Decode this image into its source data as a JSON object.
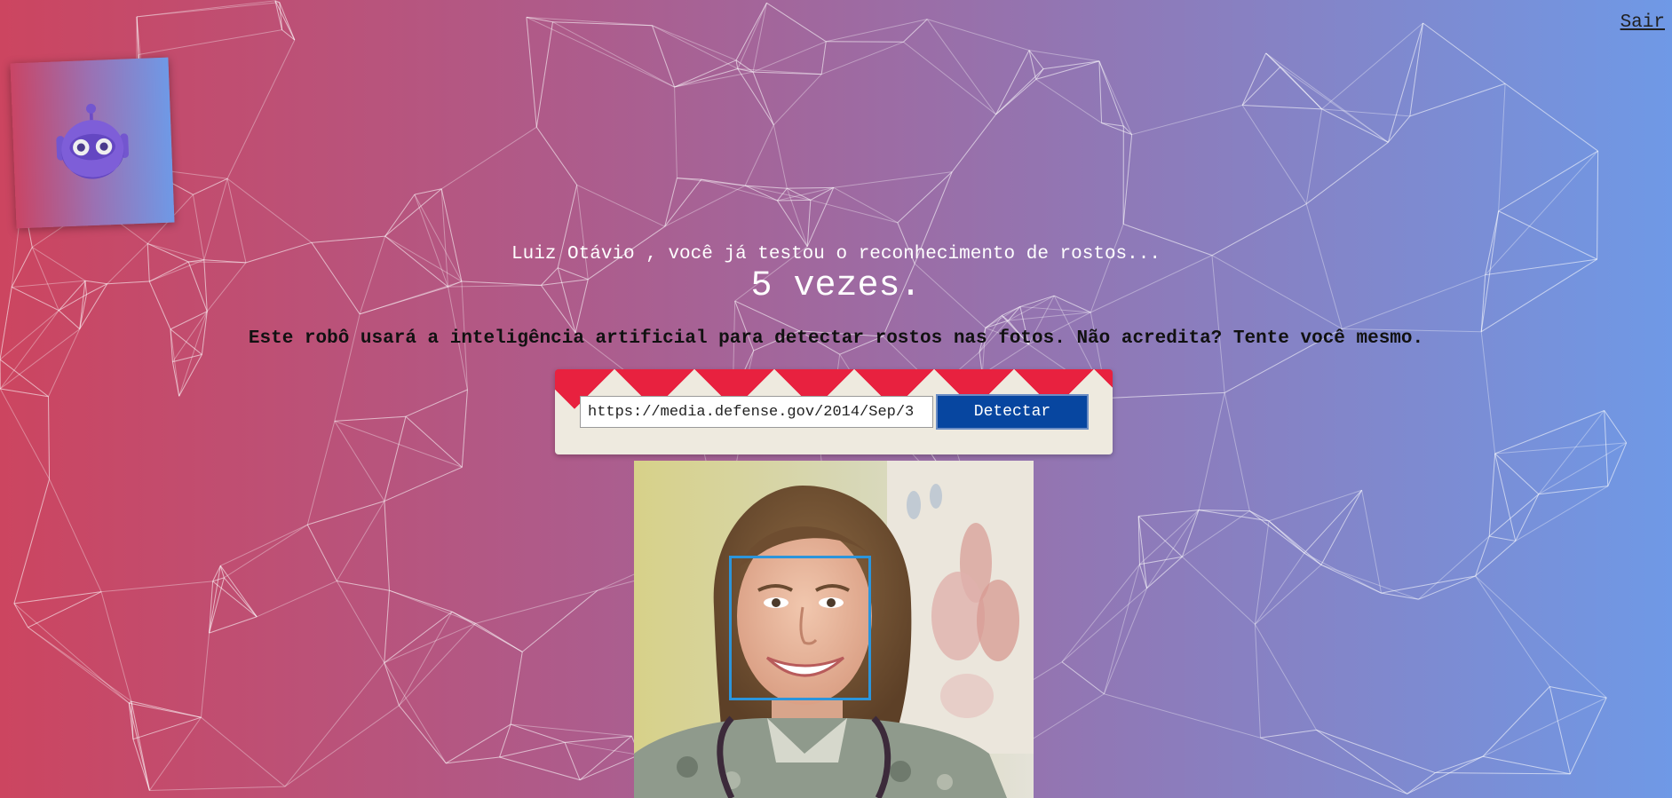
{
  "header": {
    "logout_label": "Sair"
  },
  "logo": {
    "icon": "robot-icon"
  },
  "main": {
    "greeting": "Luiz Otávio , você já testou o reconhecimento de rostos...",
    "count": "5 vezes.",
    "description": "Este robô usará a inteligência artificial para detectar rostos nas fotos. Não acredita? Tente você mesmo."
  },
  "form": {
    "url_value": "https://media.defense.gov/2014/Sep/3",
    "button_label": "Detectar"
  },
  "result": {
    "image": "detected-face-photo",
    "detection": "face-bounding-box"
  },
  "colors": {
    "gradient_left": "#cc4560",
    "gradient_right": "#6f99e6",
    "button": "#0746a0",
    "form_accent": "#e8213f",
    "face_box": "#2b95dc"
  }
}
